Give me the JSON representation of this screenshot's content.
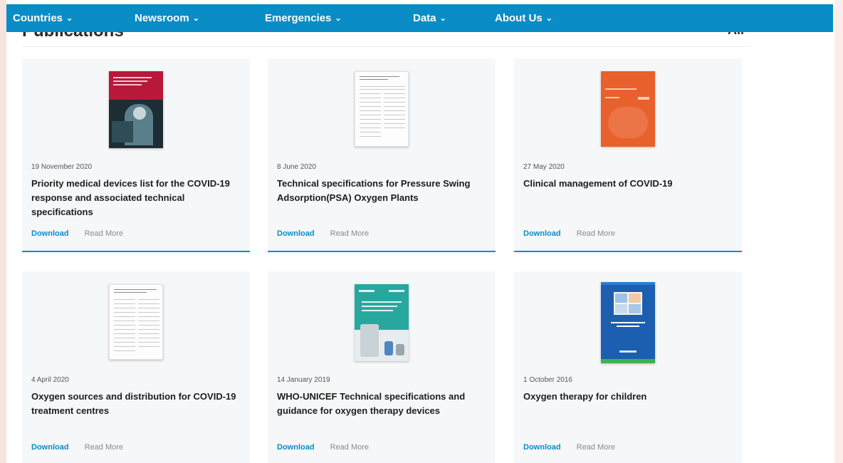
{
  "nav": {
    "items": [
      {
        "label": "Countries"
      },
      {
        "label": "Newsroom"
      },
      {
        "label": "Emergencies"
      },
      {
        "label": "Data"
      },
      {
        "label": "About Us"
      }
    ]
  },
  "section": {
    "title": "Publications",
    "all_link": "All"
  },
  "publications": [
    {
      "date": "19 November 2020",
      "title": "Priority medical devices list for the COVID-19 response and associated technical specifications",
      "download": "Download",
      "read_more": "Read More"
    },
    {
      "date": "8 June 2020",
      "title": "Technical specifications for Pressure Swing Adsorption(PSA) Oxygen Plants",
      "download": "Download",
      "read_more": "Read More"
    },
    {
      "date": "27 May 2020",
      "title": "Clinical management of COVID-19",
      "download": "Download",
      "read_more": "Read More"
    },
    {
      "date": "4 April 2020",
      "title": "Oxygen sources and distribution for COVID-19 treatment centres",
      "download": "Download",
      "read_more": "Read More"
    },
    {
      "date": "14 January 2019",
      "title": "WHO-UNICEF Technical specifications and guidance for oxygen therapy devices",
      "download": "Download",
      "read_more": "Read More"
    },
    {
      "date": "1 October 2016",
      "title": "Oxygen therapy for children",
      "download": "Download",
      "read_more": "Read More"
    }
  ],
  "colors": {
    "nav_bg": "#0a8cc6",
    "accent": "#0a8cc6",
    "card_bg": "#f6f7f8"
  },
  "icons": {
    "nav_chevron": "chevron-down-icon"
  }
}
